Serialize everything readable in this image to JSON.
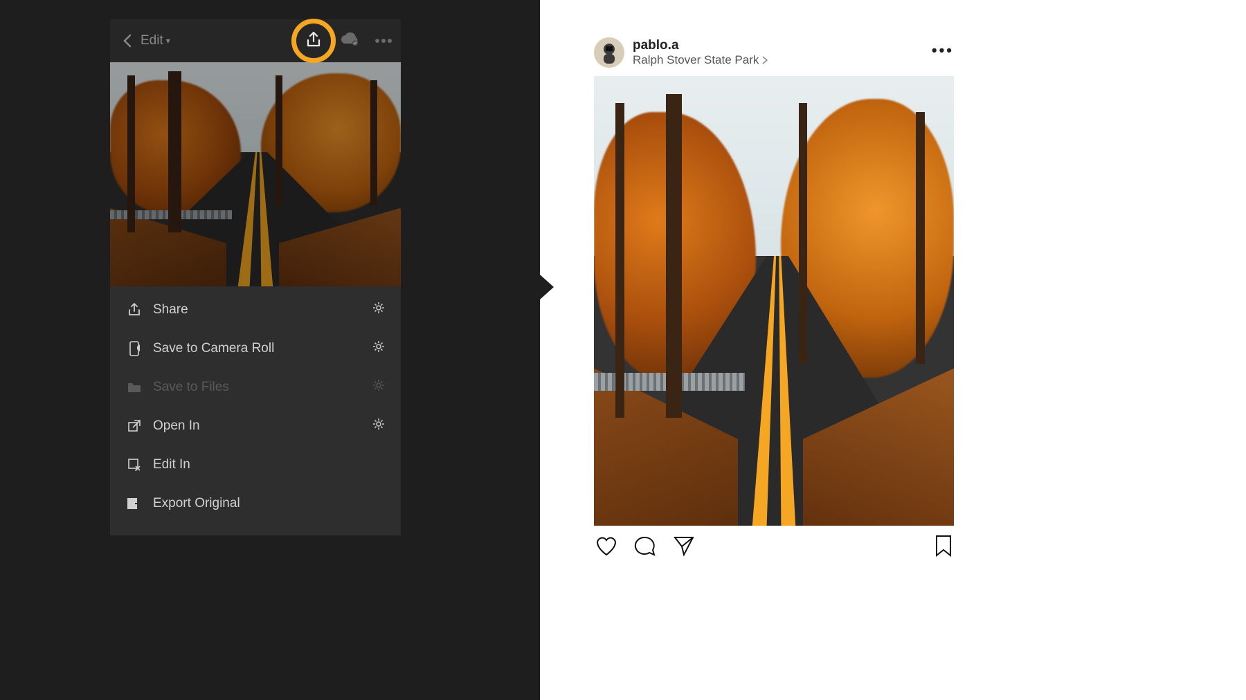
{
  "colors": {
    "highlight_ring": "#f5a623",
    "dark_bg": "#1e1e1e",
    "panel_bg": "#2e2e2e"
  },
  "lightroom": {
    "header": {
      "edit_label": "Edit",
      "back_icon": "chevron-left",
      "share_icon": "share",
      "cloud_sync_icon": "cloud-check",
      "more_icon": "ellipsis"
    },
    "menu": {
      "items": [
        {
          "icon": "share",
          "label": "Share",
          "gear": true,
          "disabled": false
        },
        {
          "icon": "device",
          "label": "Save to Camera Roll",
          "gear": true,
          "disabled": false
        },
        {
          "icon": "folder",
          "label": "Save to Files",
          "gear": true,
          "disabled": true
        },
        {
          "icon": "open-in",
          "label": "Open In",
          "gear": true,
          "disabled": false
        },
        {
          "icon": "edit-in",
          "label": "Edit In",
          "gear": false,
          "disabled": false
        },
        {
          "icon": "export",
          "label": "Export Original",
          "gear": false,
          "disabled": false
        }
      ]
    }
  },
  "instagram": {
    "username": "pablo.a",
    "location": "Ralph Stover State Park",
    "more_icon": "ellipsis",
    "actions": {
      "like_icon": "heart",
      "comment_icon": "speech-bubble",
      "send_icon": "paper-plane",
      "bookmark_icon": "bookmark"
    }
  }
}
